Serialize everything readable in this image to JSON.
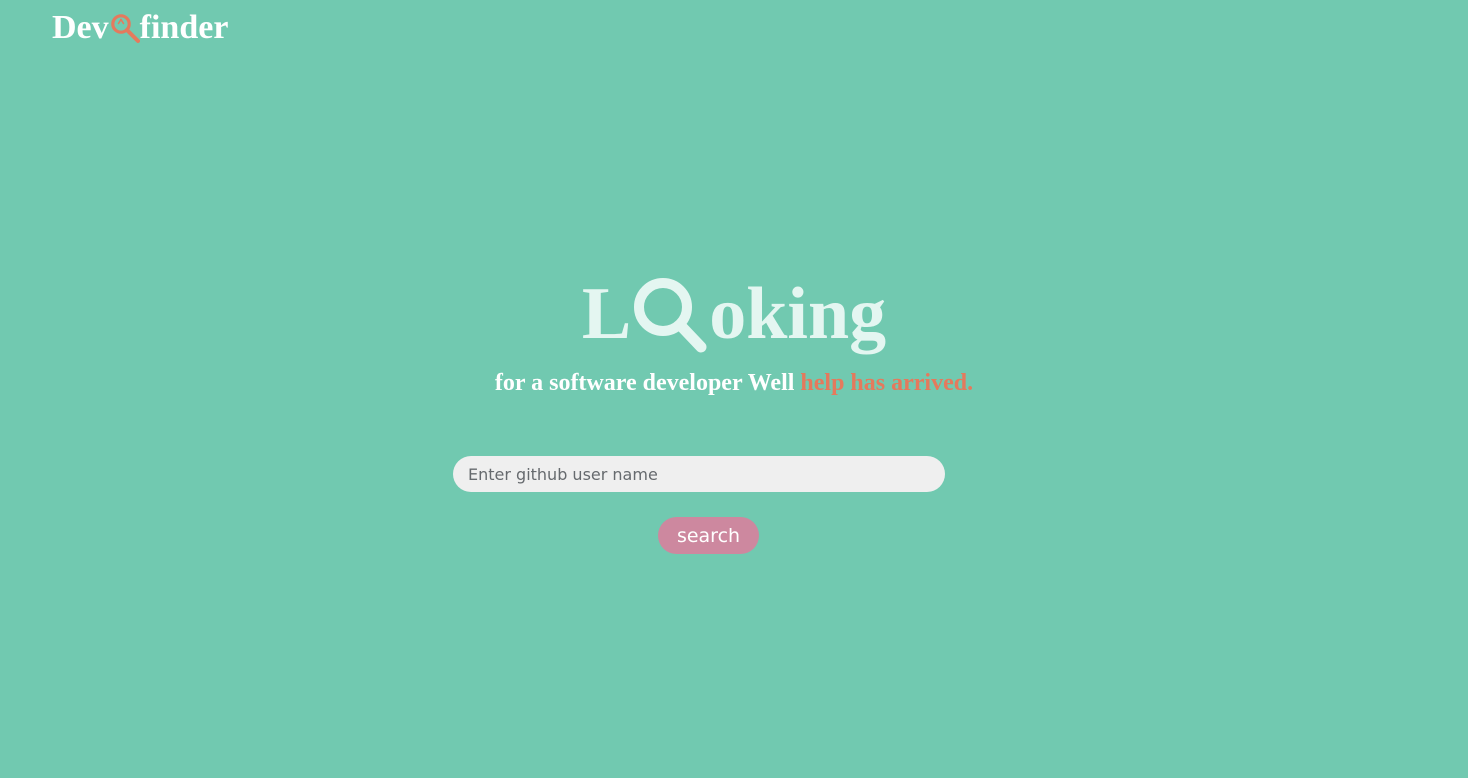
{
  "header": {
    "logo_prefix": "Dev",
    "logo_icon": "magnifier-icon",
    "logo_suffix": "finder"
  },
  "hero": {
    "title_prefix": "L",
    "title_icon": "magnifier-icon",
    "title_suffix": "oking",
    "tagline_main": "for a software developer Well ",
    "tagline_accent": "help has arrived."
  },
  "search": {
    "placeholder": "Enter github user name",
    "value": "",
    "button_label": "search"
  },
  "colors": {
    "background": "#71c9b0",
    "accent": "#e47a5d",
    "title": "#e4f6f1",
    "button": "#cd889f",
    "input_background": "#efefef"
  }
}
